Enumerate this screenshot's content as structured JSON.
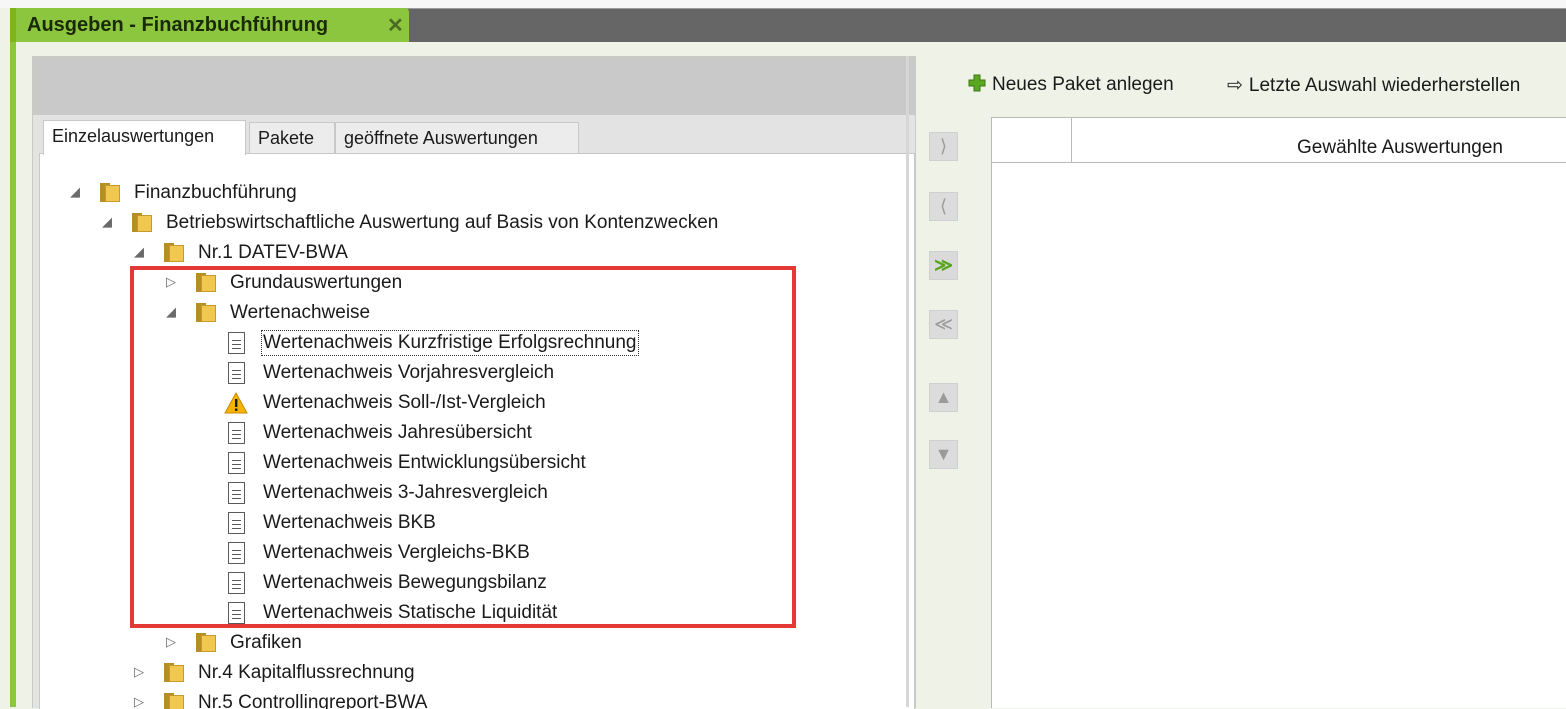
{
  "window": {
    "tab_title": "Ausgeben - Finanzbuchführung",
    "close_glyph": "✕",
    "accent_color": "#8cc63f",
    "titlebar_color": "#666666"
  },
  "left_panel": {
    "tabs": [
      {
        "label": "Einzelauswertungen",
        "active": true
      },
      {
        "label": "Pakete",
        "active": false
      },
      {
        "label": "geöffnete Auswertungen",
        "active": false
      }
    ],
    "tree": {
      "root": "Finanzbuchführung",
      "bwa_basis": "Betriebswirtschaftliche Auswertung auf Basis von Kontenzwecken",
      "nr1": "Nr.1 DATEV-BWA",
      "grundauswertungen": "Grundauswertungen",
      "wertenachweise": "Wertenachweise",
      "items": [
        {
          "label": "Wertenachweis Kurzfristige Erfolgsrechnung",
          "icon": "document-icon",
          "selected": true
        },
        {
          "label": "Wertenachweis Vorjahresvergleich",
          "icon": "document-icon"
        },
        {
          "label": "Wertenachweis Soll-/Ist-Vergleich",
          "icon": "warning-icon"
        },
        {
          "label": "Wertenachweis Jahresübersicht",
          "icon": "document-icon"
        },
        {
          "label": "Wertenachweis Entwicklungsübersicht",
          "icon": "document-icon"
        },
        {
          "label": "Wertenachweis 3-Jahresvergleich",
          "icon": "document-icon"
        },
        {
          "label": "Wertenachweis BKB",
          "icon": "document-icon"
        },
        {
          "label": "Wertenachweis Vergleichs-BKB",
          "icon": "document-icon"
        },
        {
          "label": "Wertenachweis Bewegungsbilanz",
          "icon": "document-icon"
        },
        {
          "label": "Wertenachweis Statische Liquidität",
          "icon": "document-icon"
        }
      ],
      "grafiken": "Grafiken",
      "nr4": "Nr.4 Kapitalflussrechnung",
      "nr5": "Nr.5 Controllingreport-BWA"
    },
    "highlight_color": "#e53935"
  },
  "right_panel": {
    "toolbar": {
      "new_package": "Neues Paket anlegen",
      "restore": "Letzte Auswahl wiederherstellen"
    },
    "transfer_buttons": [
      {
        "name": "add-selected-button",
        "glyph": "⟩"
      },
      {
        "name": "remove-selected-button",
        "glyph": "⟨"
      },
      {
        "name": "add-all-button",
        "glyph": "≫"
      },
      {
        "name": "remove-all-button",
        "glyph": "≪"
      },
      {
        "name": "move-up-button",
        "glyph": "▲"
      },
      {
        "name": "move-down-button",
        "glyph": "▼"
      }
    ],
    "grid_header": "Gewählte Auswertungen"
  }
}
